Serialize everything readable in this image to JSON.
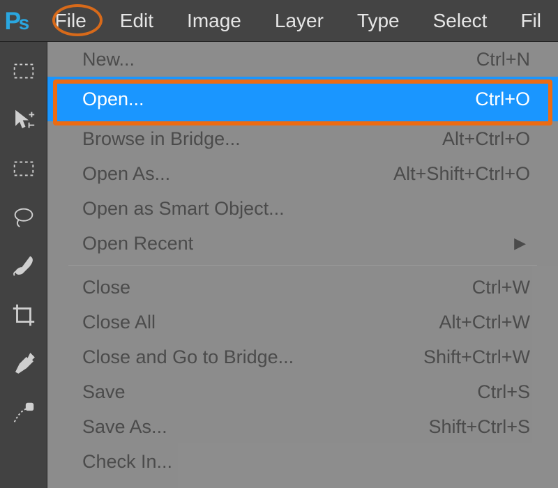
{
  "menubar": {
    "items": [
      "File",
      "Edit",
      "Image",
      "Layer",
      "Type",
      "Select",
      "Fil"
    ]
  },
  "tools": [
    "marquee-tool",
    "move-tool",
    "rect-marquee-tool",
    "lasso-tool",
    "brush-tool",
    "crop-tool",
    "eyedropper-tool",
    "healing-brush-tool"
  ],
  "menu": {
    "groups": [
      [
        {
          "label": "New...",
          "shortcut": "Ctrl+N"
        },
        {
          "label": "Open...",
          "shortcut": "Ctrl+O",
          "selected": true
        },
        {
          "label": "Browse in Bridge...",
          "shortcut": "Alt+Ctrl+O"
        },
        {
          "label": "Open As...",
          "shortcut": "Alt+Shift+Ctrl+O"
        },
        {
          "label": "Open as Smart Object...",
          "shortcut": ""
        },
        {
          "label": "Open Recent",
          "shortcut": "",
          "submenu": true
        }
      ],
      [
        {
          "label": "Close",
          "shortcut": "Ctrl+W"
        },
        {
          "label": "Close All",
          "shortcut": "Alt+Ctrl+W"
        },
        {
          "label": "Close and Go to Bridge...",
          "shortcut": "Shift+Ctrl+W"
        },
        {
          "label": "Save",
          "shortcut": "Ctrl+S"
        },
        {
          "label": "Save As...",
          "shortcut": "Shift+Ctrl+S"
        },
        {
          "label": "Check In...",
          "shortcut": ""
        }
      ]
    ]
  }
}
